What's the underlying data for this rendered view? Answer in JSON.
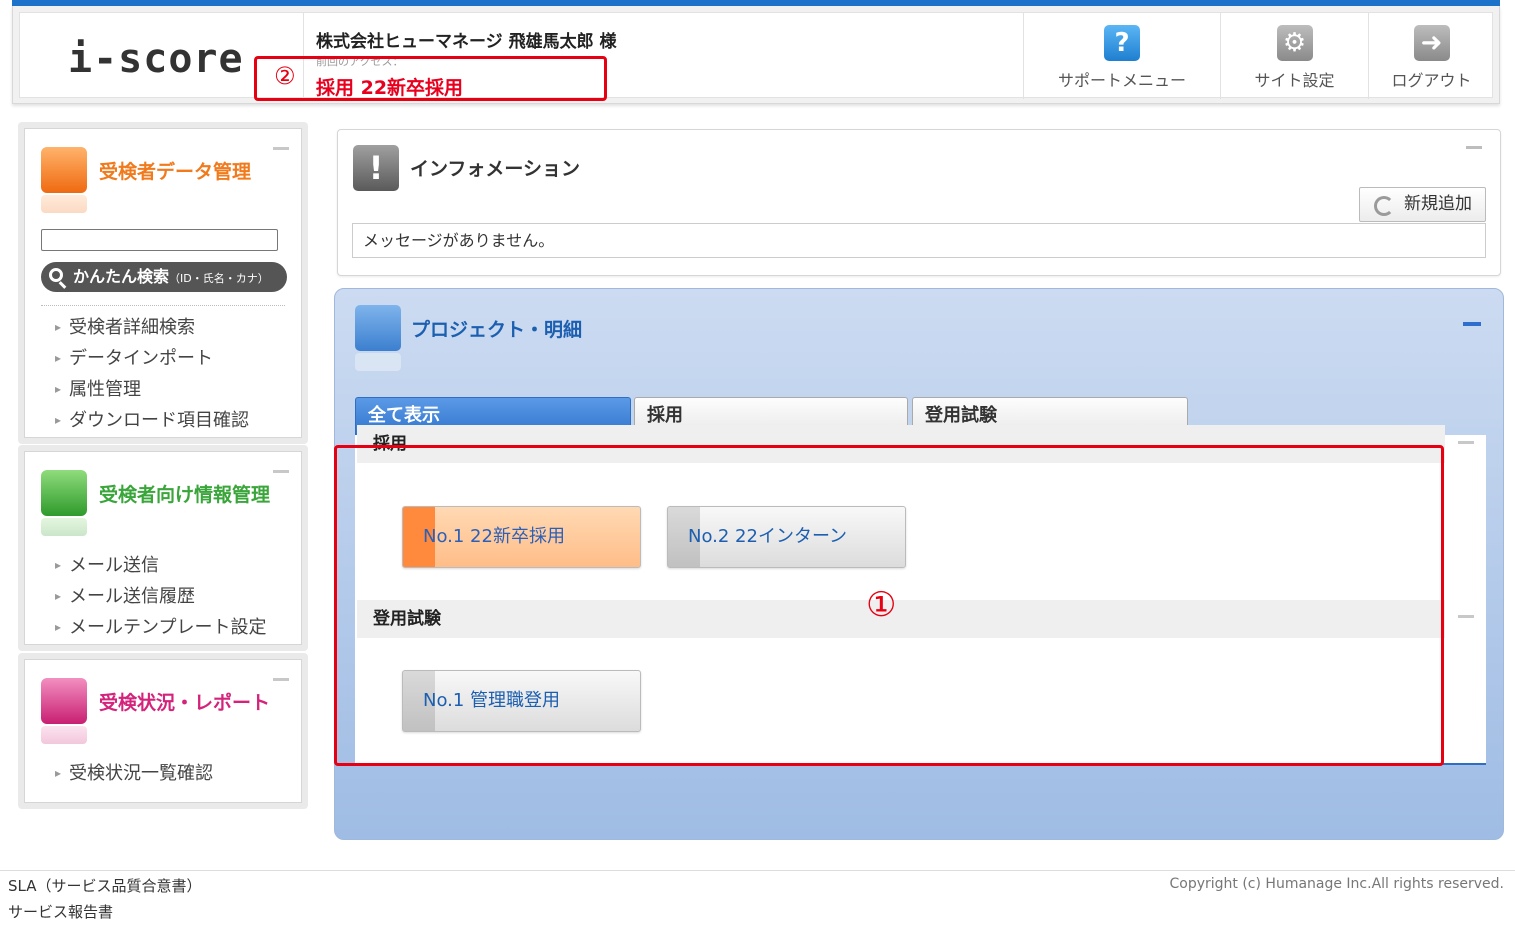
{
  "header": {
    "logo": "i-score",
    "company_user": "株式会社ヒューマネージ 飛雄馬太郎 様",
    "last_access": "前回のアクセス：",
    "current_project": "採用 22新卒採用",
    "buttons": [
      {
        "label": "サポートメニュー",
        "icon": "help-icon",
        "glyph": "?"
      },
      {
        "label": "サイト設定",
        "icon": "gear-icon",
        "glyph": "⚙"
      },
      {
        "label": "ログアウト",
        "icon": "logout-icon",
        "glyph": "➜"
      }
    ]
  },
  "annotations": {
    "marker1": "①",
    "marker2": "②",
    "box_color": "#e60012"
  },
  "sidebar": {
    "panels": [
      {
        "title": "受検者データ管理",
        "color": "#f07a1c",
        "icon": "user-data-icon",
        "search_button": "かんたん検索",
        "search_note": "（ID・氏名・カナ）",
        "search_value": "",
        "links": [
          "受検者詳細検索",
          "データインポート",
          "属性管理",
          "ダウンロード項目確認"
        ]
      },
      {
        "title": "受検者向け情報管理",
        "color": "#3aa53a",
        "icon": "paper-plane-icon",
        "links": [
          "メール送信",
          "メール送信履歴",
          "メールテンプレート設定"
        ]
      },
      {
        "title": "受検状況・レポート",
        "color": "#d4237a",
        "icon": "report-chart-icon",
        "links": [
          "受検状況一覧確認"
        ]
      }
    ]
  },
  "info": {
    "title": "インフォメーション",
    "new_button": "新規追加",
    "message": "メッセージがありません。"
  },
  "project": {
    "title": "プロジェクト・明細",
    "tabs": [
      "全て表示",
      "採用",
      "登用試験"
    ],
    "active_tab": 0,
    "sections": [
      {
        "name": "採用",
        "items": [
          {
            "label": "No.1 22新卒採用",
            "selected": true
          },
          {
            "label": "No.2 22インターン",
            "selected": false
          }
        ]
      },
      {
        "name": "登用試験",
        "items": [
          {
            "label": "No.1 管理職登用",
            "selected": false
          }
        ]
      }
    ]
  },
  "footer": {
    "links": [
      "SLA（サービス品質合意書）",
      "サービス報告書"
    ],
    "copyright": "Copyright (c) Humanage Inc.All rights reserved."
  }
}
